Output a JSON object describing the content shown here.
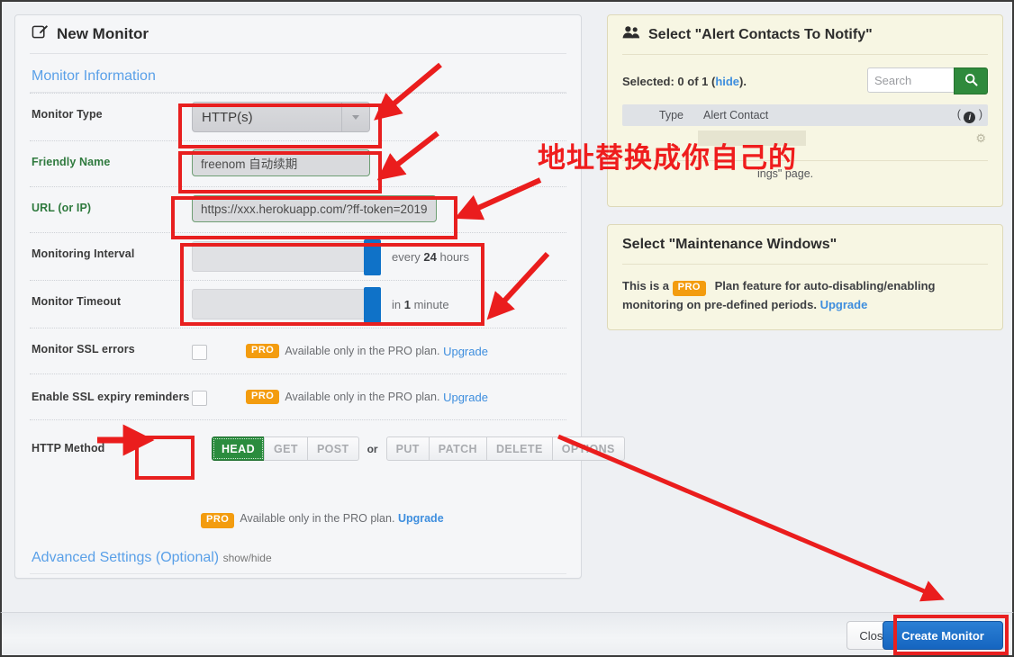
{
  "left_panel": {
    "title": "New Monitor",
    "title_icon": "edit-square-icon",
    "section_heading": "Monitor Information",
    "rows": {
      "monitor_type": {
        "label": "Monitor Type",
        "value": "HTTP(s)"
      },
      "friendly_name": {
        "label": "Friendly Name",
        "value": "freenom 自动续期"
      },
      "url": {
        "label": "URL (or IP)",
        "value": "https://xxx.herokuapp.com/?ff-token=2019"
      },
      "monitoring_interval": {
        "label": "Monitoring Interval",
        "text_prefix": "every ",
        "text_value": "24",
        "text_suffix": " hours",
        "handle_pct": 100
      },
      "monitor_timeout": {
        "label": "Monitor Timeout",
        "text_prefix": "in ",
        "text_value": "1",
        "text_suffix": " minute",
        "handle_pct": 100
      },
      "ssl_errors": {
        "label": "Monitor SSL errors",
        "badge": "PRO",
        "note": "Available only in the PRO plan.",
        "link": "Upgrade",
        "checked": false
      },
      "ssl_expiry": {
        "label": "Enable SSL expiry reminders",
        "badge": "PRO",
        "note": "Available only in the PRO plan.",
        "link": "Upgrade",
        "checked": false
      },
      "http_method": {
        "label": "HTTP Method",
        "free_methods": [
          "HEAD",
          "GET",
          "POST"
        ],
        "separator": "or",
        "pro_methods": [
          "PUT",
          "PATCH",
          "DELETE",
          "OPTIONS"
        ],
        "selected": "HEAD",
        "badge": "PRO",
        "note": "Available only in the PRO plan.",
        "link": "Upgrade"
      }
    },
    "advanced": {
      "title": "Advanced Settings (Optional)",
      "toggle": "show/hide"
    }
  },
  "alerts_panel": {
    "title": "Select \"Alert Contacts To Notify\"",
    "title_icon": "users-icon",
    "selected_label": "Selected: 0 of 1 (",
    "selected_link": "hide",
    "selected_suffix": ").",
    "search_placeholder": "Search",
    "search_icon": "magnifier-icon",
    "columns": {
      "type": "Type",
      "contact": "Alert Contact",
      "info": "( i )"
    },
    "row_note": "ings\" page.",
    "gear_icon": "gear-icon"
  },
  "maintenance_panel": {
    "title": "Select \"Maintenance Windows\"",
    "text_before": "This is a ",
    "badge": "PRO",
    "text_after": " Plan feature for auto-disabling/enabling monitoring on pre-defined periods. ",
    "link": "Upgrade"
  },
  "footer": {
    "close_label": "Close",
    "create_label": "Create Monitor"
  },
  "annotation": {
    "note_text": "地址替换成你自己的",
    "color": "#ef1d1d"
  },
  "colors": {
    "accent_blue": "#1565c0",
    "pro_orange": "#f39c0f",
    "green": "#2b8c3e",
    "annotation_red": "#e81f1f",
    "link_blue": "#3e8ede"
  }
}
